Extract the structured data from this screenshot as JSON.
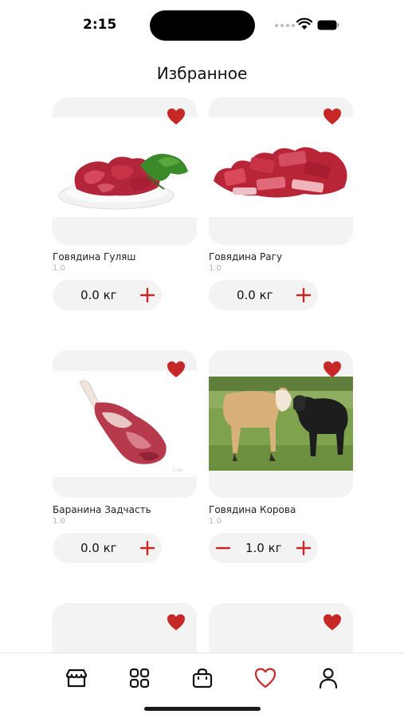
{
  "status_bar": {
    "time": "2:15"
  },
  "page": {
    "title": "Избранное"
  },
  "products": [
    {
      "name": "Говядина Гуляш",
      "sub": "1.0",
      "quantity": "0.0 кг",
      "favorite": true,
      "icon": "meat-goulash-photo"
    },
    {
      "name": "Говядина Рагу",
      "sub": "1.0",
      "quantity": "0.0 кг",
      "favorite": true,
      "icon": "meat-ribs-photo"
    },
    {
      "name": "Баранина Задчасть",
      "sub": "1.0",
      "quantity": "0.0 кг",
      "favorite": true,
      "icon": "lamb-leg-photo"
    },
    {
      "name": "Говядина  Корова",
      "sub": "1.0",
      "quantity": "1.0 кг",
      "favorite": true,
      "icon": "cows-photo"
    },
    {
      "favorite": true
    },
    {
      "favorite": true
    }
  ],
  "nav": {
    "items": [
      {
        "icon": "store-icon",
        "active": false
      },
      {
        "icon": "grid-icon",
        "active": false
      },
      {
        "icon": "bag-icon",
        "active": false
      },
      {
        "icon": "heart-icon",
        "active": true
      },
      {
        "icon": "profile-icon",
        "active": false
      }
    ]
  },
  "colors": {
    "accent": "#c62828",
    "card_bg": "#f3f3f3",
    "muted_text": "#b5b5b5"
  }
}
